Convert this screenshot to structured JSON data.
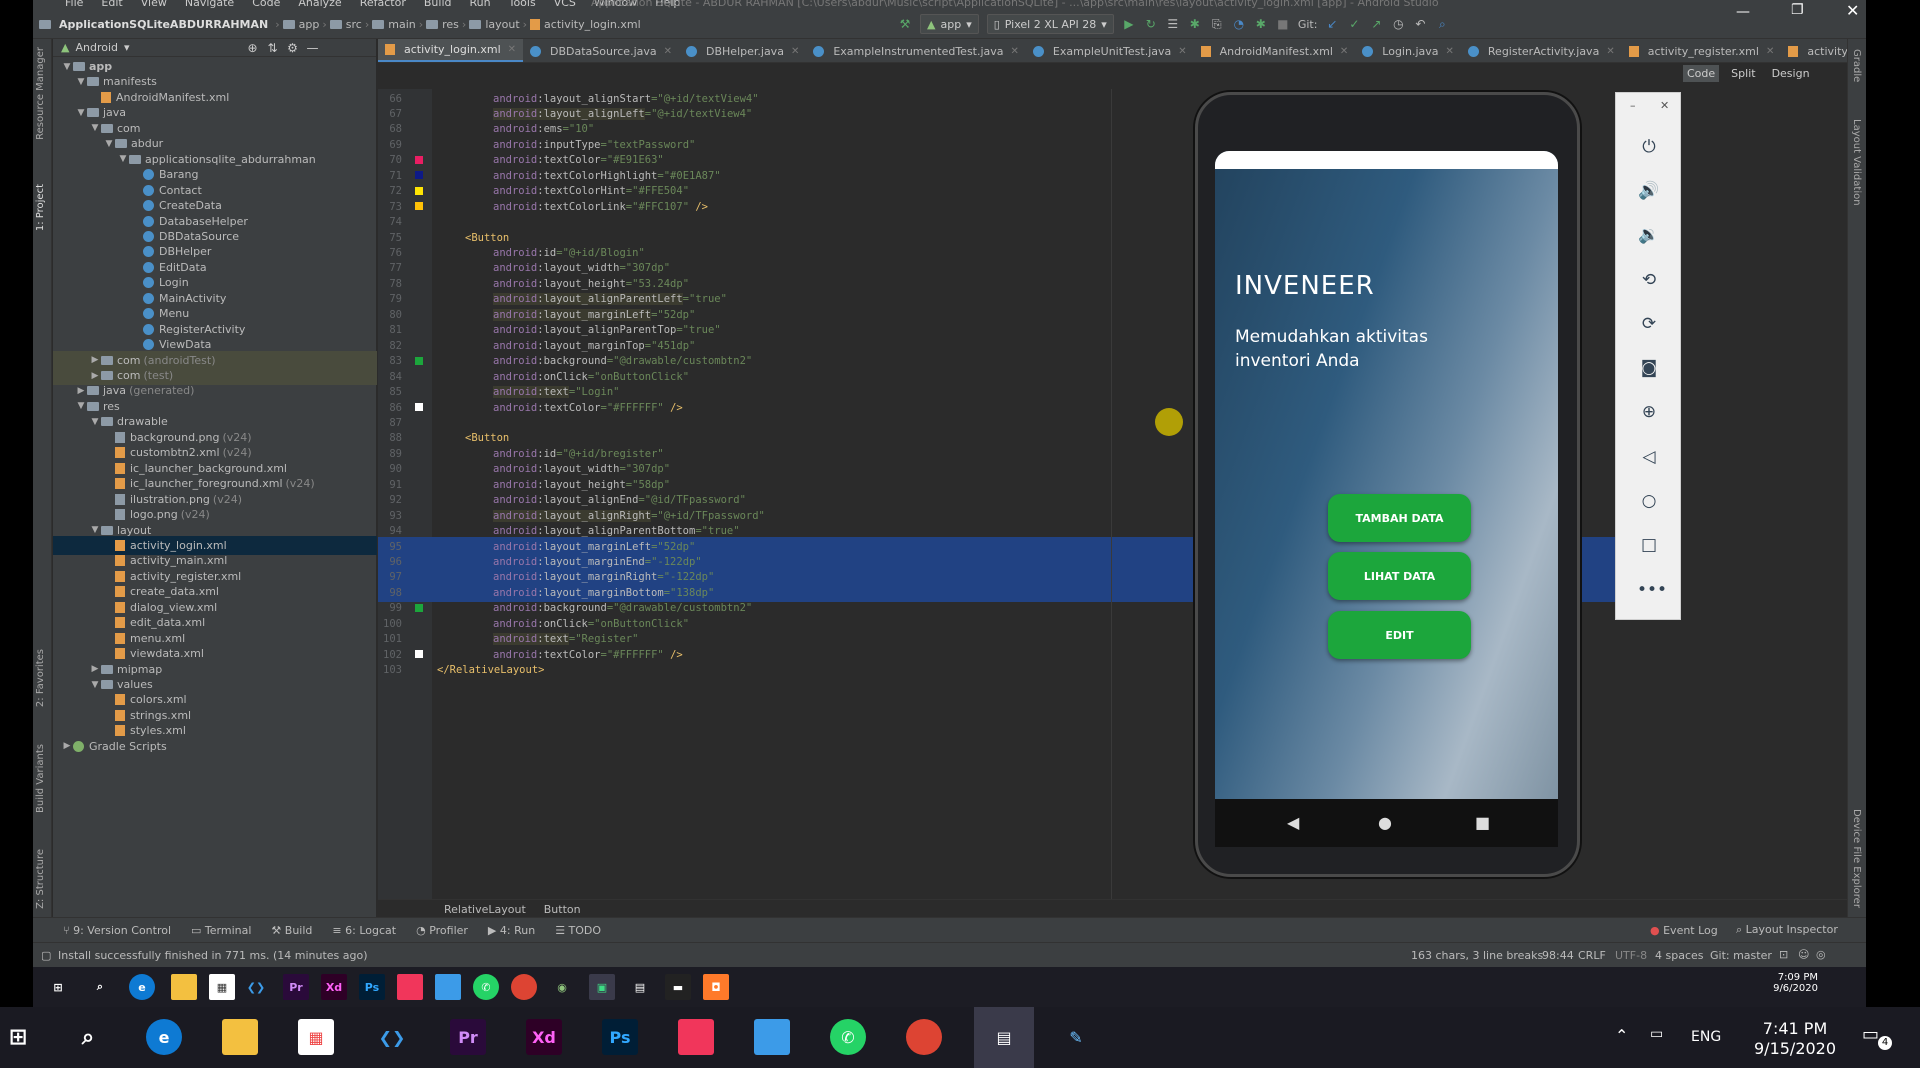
{
  "window": {
    "title": "Application SQLite - ABDUR RAHMAN [C:\\Users\\abdur\\Music\\script\\ApplicationSQLite] - ...\\app\\src\\main\\res\\layout\\activity_login.xml [app] - Android Studio"
  },
  "menu": [
    "File",
    "Edit",
    "View",
    "Navigate",
    "Code",
    "Analyze",
    "Refactor",
    "Build",
    "Run",
    "Tools",
    "VCS",
    "Window",
    "Help"
  ],
  "breadcrumb": {
    "project": "ApplicationSQLiteABDURRAHMAN",
    "items": [
      "app",
      "src",
      "main",
      "res",
      "layout",
      "activity_login.xml"
    ]
  },
  "toolbar": {
    "run_config": "app",
    "device": "Pixel 2 XL API 28",
    "git_label": "Git:"
  },
  "project_panel": {
    "mode": "Android",
    "tree": [
      {
        "label": "app",
        "level": 0,
        "type": "folder",
        "expanded": true
      },
      {
        "label": "manifests",
        "level": 1,
        "type": "folder",
        "expanded": true
      },
      {
        "label": "AndroidManifest.xml",
        "level": 2,
        "type": "xml"
      },
      {
        "label": "java",
        "level": 1,
        "type": "folder",
        "expanded": true
      },
      {
        "label": "com",
        "level": 2,
        "type": "folder",
        "expanded": true
      },
      {
        "label": "abdur",
        "level": 3,
        "type": "folder",
        "expanded": true
      },
      {
        "label": "applicationsqlite_abdurrahman",
        "level": 4,
        "type": "folder",
        "expanded": true
      },
      {
        "label": "Barang",
        "level": 5,
        "type": "class"
      },
      {
        "label": "Contact",
        "level": 5,
        "type": "class"
      },
      {
        "label": "CreateData",
        "level": 5,
        "type": "class"
      },
      {
        "label": "DatabaseHelper",
        "level": 5,
        "type": "class"
      },
      {
        "label": "DBDataSource",
        "level": 5,
        "type": "class"
      },
      {
        "label": "DBHelper",
        "level": 5,
        "type": "class"
      },
      {
        "label": "EditData",
        "level": 5,
        "type": "class"
      },
      {
        "label": "Login",
        "level": 5,
        "type": "class"
      },
      {
        "label": "MainActivity",
        "level": 5,
        "type": "class"
      },
      {
        "label": "Menu",
        "level": 5,
        "type": "class"
      },
      {
        "label": "RegisterActivity",
        "level": 5,
        "type": "class"
      },
      {
        "label": "ViewData",
        "level": 5,
        "type": "class"
      },
      {
        "label": "com",
        "suffix": "(androidTest)",
        "level": 2,
        "type": "folder",
        "expanded": false,
        "hl": true
      },
      {
        "label": "com",
        "suffix": "(test)",
        "level": 2,
        "type": "folder",
        "expanded": false,
        "hl": true
      },
      {
        "label": "java",
        "suffix": "(generated)",
        "level": 1,
        "type": "folder",
        "expanded": false
      },
      {
        "label": "res",
        "level": 1,
        "type": "folder",
        "expanded": true
      },
      {
        "label": "drawable",
        "level": 2,
        "type": "folder",
        "expanded": true
      },
      {
        "label": "background.png",
        "suffix": "(v24)",
        "level": 3,
        "type": "png"
      },
      {
        "label": "custombtn2.xml",
        "suffix": "(v24)",
        "level": 3,
        "type": "xml"
      },
      {
        "label": "ic_launcher_background.xml",
        "level": 3,
        "type": "xml"
      },
      {
        "label": "ic_launcher_foreground.xml",
        "suffix": "(v24)",
        "level": 3,
        "type": "xml"
      },
      {
        "label": "ilustration.png",
        "suffix": "(v24)",
        "level": 3,
        "type": "png"
      },
      {
        "label": "logo.png",
        "suffix": "(v24)",
        "level": 3,
        "type": "png"
      },
      {
        "label": "layout",
        "level": 2,
        "type": "folder",
        "expanded": true
      },
      {
        "label": "activity_login.xml",
        "level": 3,
        "type": "xml",
        "selected": true
      },
      {
        "label": "activity_main.xml",
        "level": 3,
        "type": "xml"
      },
      {
        "label": "activity_register.xml",
        "level": 3,
        "type": "xml"
      },
      {
        "label": "create_data.xml",
        "level": 3,
        "type": "xml"
      },
      {
        "label": "dialog_view.xml",
        "level": 3,
        "type": "xml"
      },
      {
        "label": "edit_data.xml",
        "level": 3,
        "type": "xml"
      },
      {
        "label": "menu.xml",
        "level": 3,
        "type": "xml"
      },
      {
        "label": "viewdata.xml",
        "level": 3,
        "type": "xml"
      },
      {
        "label": "mipmap",
        "level": 2,
        "type": "folder",
        "expanded": false
      },
      {
        "label": "values",
        "level": 2,
        "type": "folder",
        "expanded": true
      },
      {
        "label": "colors.xml",
        "level": 3,
        "type": "xml"
      },
      {
        "label": "strings.xml",
        "level": 3,
        "type": "xml"
      },
      {
        "label": "styles.xml",
        "level": 3,
        "type": "xml"
      },
      {
        "label": "Gradle Scripts",
        "level": 0,
        "type": "gradle",
        "expanded": false
      }
    ]
  },
  "side_tools_left": [
    "Resource Manager",
    "1: Project",
    "2: Favorites",
    "Build Variants",
    "Z: Structure"
  ],
  "side_tools_right": [
    "Gradle",
    "Layout Validation",
    "Device File Explorer"
  ],
  "tabs": [
    {
      "label": "activity_login.xml",
      "active": true
    },
    {
      "label": "DBDataSource.java"
    },
    {
      "label": "DBHelper.java"
    },
    {
      "label": "ExampleInstrumentedTest.java"
    },
    {
      "label": "ExampleUnitTest.java"
    },
    {
      "label": "AndroidManifest.xml"
    },
    {
      "label": "Login.java"
    },
    {
      "label": "RegisterActivity.java"
    },
    {
      "label": "activity_register.xml"
    },
    {
      "label": "activity_main.xml"
    }
  ],
  "editor_modes": [
    "Code",
    "Split",
    "Design"
  ],
  "code_lines": [
    {
      "n": "66",
      "i": 2,
      "a": "layout_alignStart",
      "v": "@+id/textView4"
    },
    {
      "n": "67",
      "i": 2,
      "a": "layout_alignLeft",
      "v": "@+id/textView4",
      "hl": true
    },
    {
      "n": "68",
      "i": 2,
      "a": "ems",
      "v": "10"
    },
    {
      "n": "69",
      "i": 2,
      "a": "inputType",
      "v": "textPassword"
    },
    {
      "n": "70",
      "i": 2,
      "a": "textColor",
      "v": "#E91E63",
      "sw": "#E91E63"
    },
    {
      "n": "71",
      "i": 2,
      "a": "textColorHighlight",
      "v": "#0E1A87",
      "sw": "#0E1A87"
    },
    {
      "n": "72",
      "i": 2,
      "a": "textColorHint",
      "v": "#FFE504",
      "sw": "#FFE504"
    },
    {
      "n": "73",
      "i": 2,
      "a": "textColorLink",
      "v": "#FFC107",
      "close": " />",
      "sw": "#FFC107"
    },
    {
      "n": "74",
      "raw": ""
    },
    {
      "n": "75",
      "i": 1,
      "tag": "<Button"
    },
    {
      "n": "76",
      "i": 2,
      "a": "id",
      "v": "@+id/Blogin"
    },
    {
      "n": "77",
      "i": 2,
      "a": "layout_width",
      "v": "307dp"
    },
    {
      "n": "78",
      "i": 2,
      "a": "layout_height",
      "v": "53.24dp"
    },
    {
      "n": "79",
      "i": 2,
      "a": "layout_alignParentLeft",
      "v": "true",
      "hl": true
    },
    {
      "n": "80",
      "i": 2,
      "a": "layout_marginLeft",
      "v": "52dp",
      "hl": true
    },
    {
      "n": "81",
      "i": 2,
      "a": "layout_alignParentTop",
      "v": "true"
    },
    {
      "n": "82",
      "i": 2,
      "a": "layout_marginTop",
      "v": "451dp"
    },
    {
      "n": "83",
      "i": 2,
      "a": "background",
      "v": "@drawable/custombtn2",
      "sw": "#1ca63c"
    },
    {
      "n": "84",
      "i": 2,
      "a": "onClick",
      "v": "onButtonClick"
    },
    {
      "n": "85",
      "i": 2,
      "a": "text",
      "v": "Login",
      "hl": true
    },
    {
      "n": "86",
      "i": 2,
      "a": "textColor",
      "v": "#FFFFFF",
      "close": " />",
      "sw": "#FFFFFF"
    },
    {
      "n": "87",
      "raw": ""
    },
    {
      "n": "88",
      "i": 1,
      "tag": "<Button"
    },
    {
      "n": "89",
      "i": 2,
      "a": "id",
      "v": "@+id/bregister"
    },
    {
      "n": "90",
      "i": 2,
      "a": "layout_width",
      "v": "307dp"
    },
    {
      "n": "91",
      "i": 2,
      "a": "layout_height",
      "v": "58dp"
    },
    {
      "n": "92",
      "i": 2,
      "a": "layout_alignEnd",
      "v": "@id/TFpassword"
    },
    {
      "n": "93",
      "i": 2,
      "a": "layout_alignRight",
      "v": "@+id/TFpassword",
      "hl": true
    },
    {
      "n": "94",
      "i": 2,
      "a": "layout_alignParentBottom",
      "v": "true"
    },
    {
      "n": "95",
      "i": 2,
      "a": "layout_marginLeft",
      "v": "52dp",
      "sel": true
    },
    {
      "n": "96",
      "i": 2,
      "a": "layout_marginEnd",
      "v": "-122dp",
      "sel": true
    },
    {
      "n": "97",
      "i": 2,
      "a": "layout_marginRight",
      "v": "-122dp",
      "sel": true
    },
    {
      "n": "98",
      "i": 2,
      "a": "layout_marginBottom",
      "v": "138dp",
      "sel": true
    },
    {
      "n": "99",
      "i": 2,
      "a": "background",
      "v": "@drawable/custombtn2",
      "sw": "#1ca63c"
    },
    {
      "n": "100",
      "i": 2,
      "a": "onClick",
      "v": "onButtonClick"
    },
    {
      "n": "101",
      "i": 2,
      "a": "text",
      "v": "Register",
      "hl": true
    },
    {
      "n": "102",
      "i": 2,
      "a": "textColor",
      "v": "#FFFFFF",
      "close": " />",
      "sw": "#FFFFFF"
    },
    {
      "n": "103",
      "i": 0,
      "tag": "</RelativeLayout>"
    }
  ],
  "editor_breadcrumb": [
    "RelativeLayout",
    "Button"
  ],
  "emulator": {
    "app_title": "INVENEER",
    "app_subtitle": "Memudahkan aktivitas inventori Anda",
    "buttons": [
      "TAMBAH DATA",
      "LIHAT DATA",
      "EDIT"
    ],
    "nav": [
      "◀",
      "●",
      "■"
    ]
  },
  "emu_controls": [
    "power-icon",
    "volume-up-icon",
    "volume-down-icon",
    "rotate-left-icon",
    "rotate-right-icon",
    "screenshot-icon",
    "zoom-icon",
    "back-icon",
    "home-icon",
    "overview-icon",
    "more-icon"
  ],
  "bottom_tools": [
    "9: Version Control",
    "Terminal",
    "Build",
    "6: Logcat",
    "Profiler",
    "4: Run",
    "TODO"
  ],
  "bottom_tools_right": [
    "Event Log",
    "Layout Inspector"
  ],
  "status": {
    "message": "Install successfully finished in 771 ms. (14 minutes ago)",
    "selection": "163 chars, 3 line breaks",
    "position": "98:44",
    "line_sep": "CRLF",
    "encoding": "UTF-8",
    "indent": "4 spaces",
    "git": "Git: master"
  },
  "inner_clock": {
    "time": "7:09 PM",
    "date": "9/6/2020"
  },
  "taskbar": {
    "time": "7:41 PM",
    "date": "9/15/2020",
    "lang": "ENG",
    "notifications": "4"
  }
}
